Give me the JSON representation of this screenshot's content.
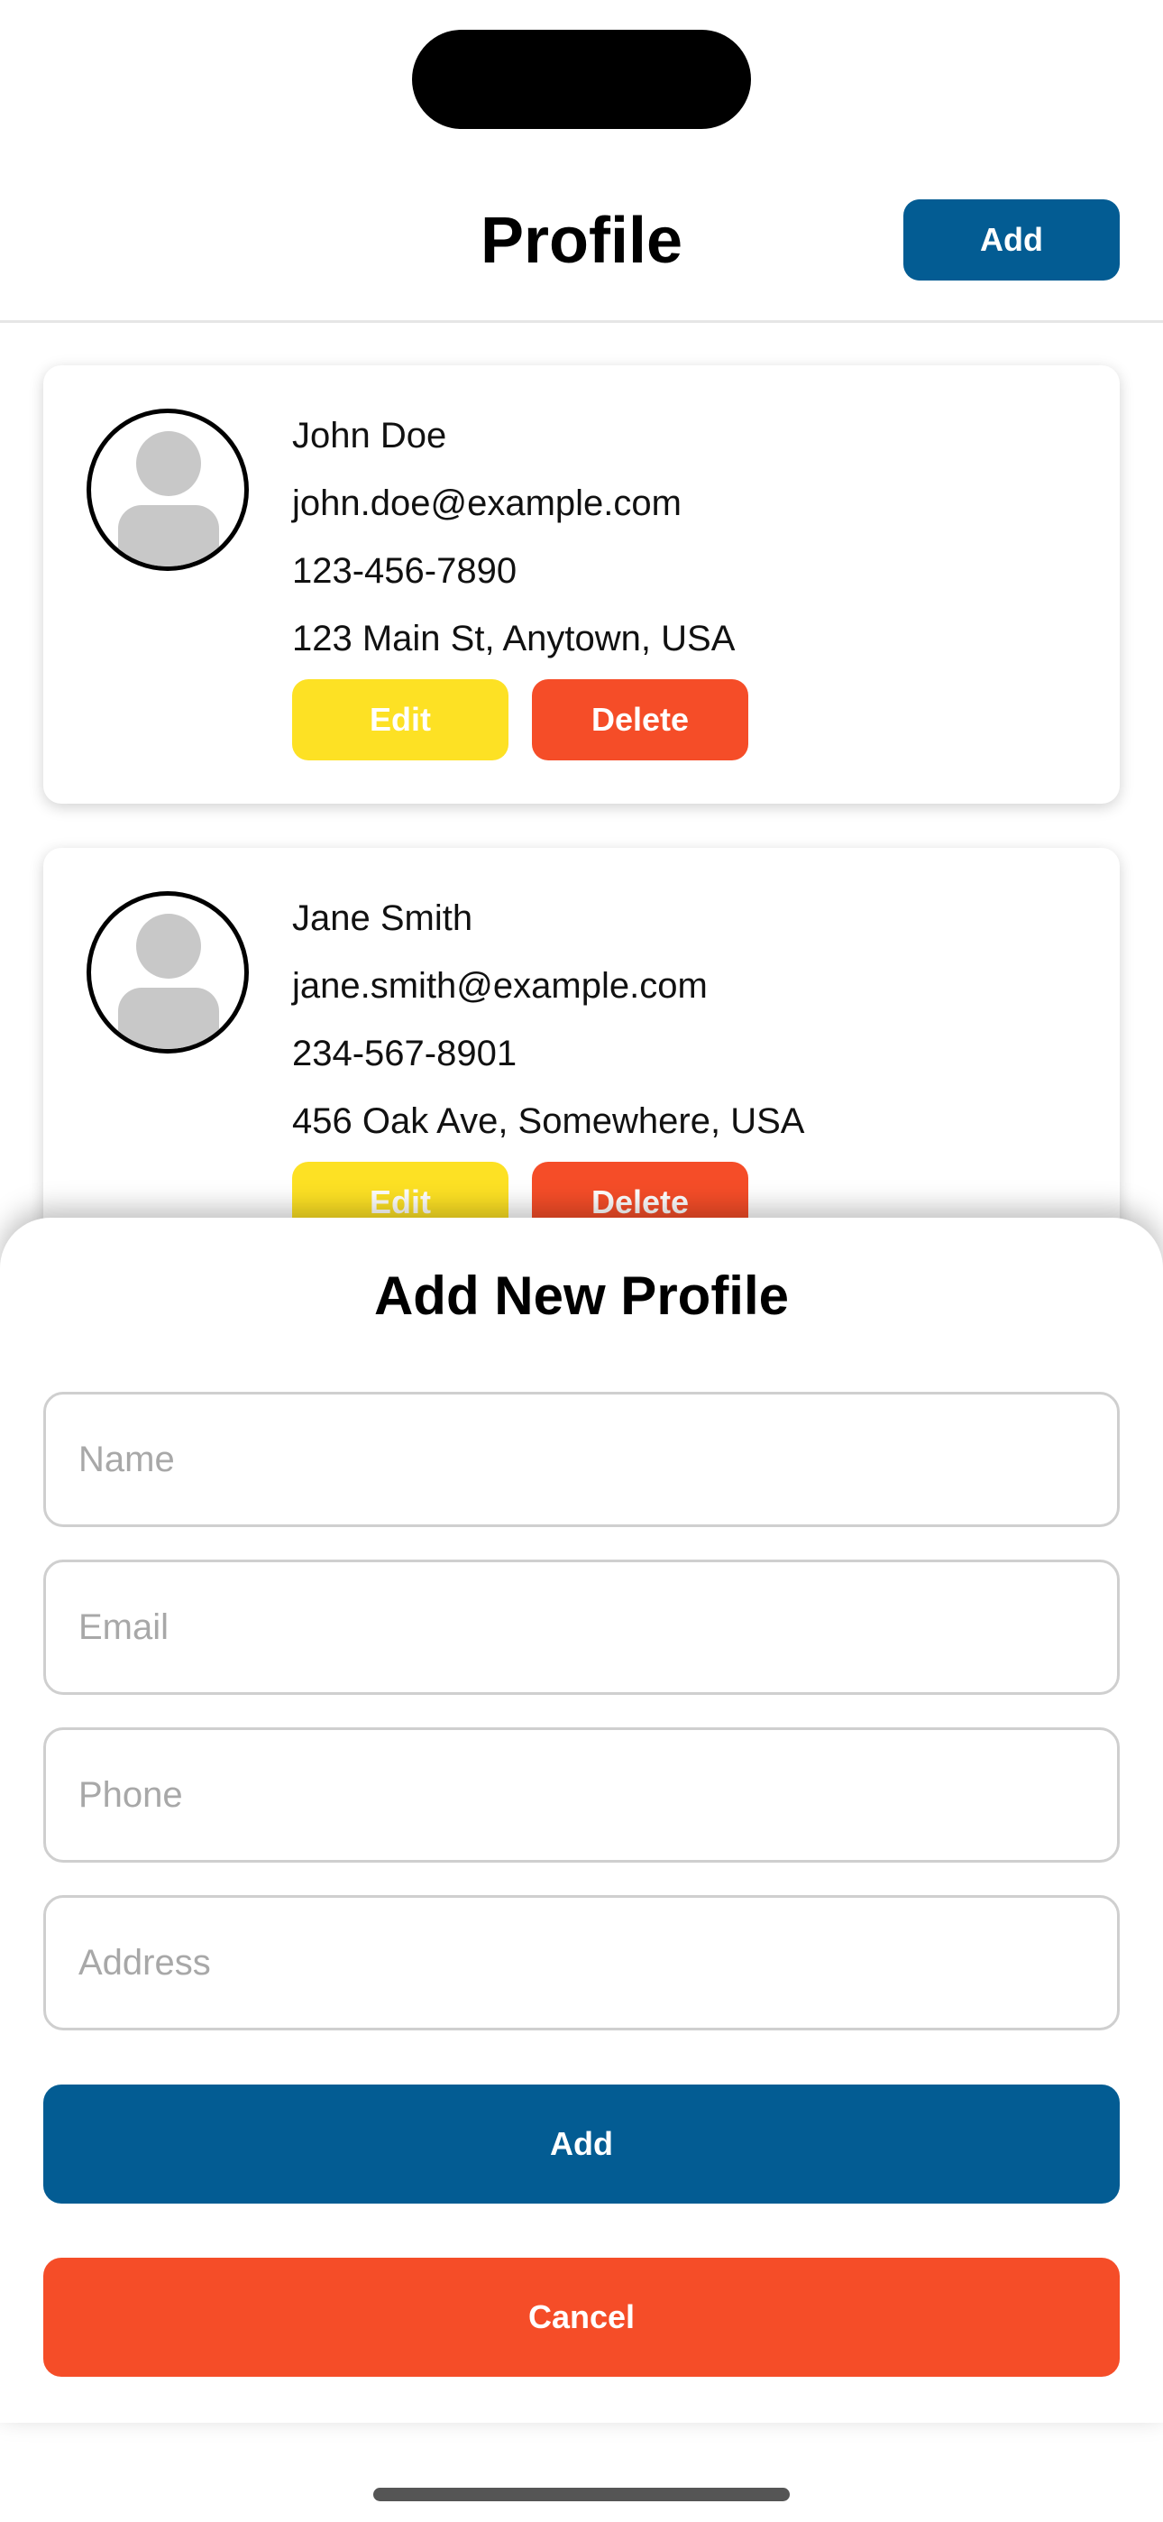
{
  "header": {
    "title": "Profile",
    "add_label": "Add"
  },
  "profiles": [
    {
      "name": "John Doe",
      "email": "john.doe@example.com",
      "phone": "123-456-7890",
      "address": "123 Main St, Anytown, USA",
      "edit_label": "Edit",
      "delete_label": "Delete"
    },
    {
      "name": "Jane Smith",
      "email": "jane.smith@example.com",
      "phone": "234-567-8901",
      "address": "456 Oak Ave, Somewhere, USA",
      "edit_label": "Edit",
      "delete_label": "Delete"
    }
  ],
  "sheet": {
    "title": "Add New Profile",
    "fields": [
      {
        "value": "",
        "placeholder": "Name"
      },
      {
        "value": "",
        "placeholder": "Email"
      },
      {
        "value": "",
        "placeholder": "Phone"
      },
      {
        "value": "",
        "placeholder": "Address"
      }
    ],
    "add_label": "Add",
    "cancel_label": "Cancel"
  },
  "colors": {
    "primary": "#035c93",
    "edit": "#fde124",
    "danger": "#f54d28",
    "avatar_placeholder": "#c8c8c8"
  }
}
